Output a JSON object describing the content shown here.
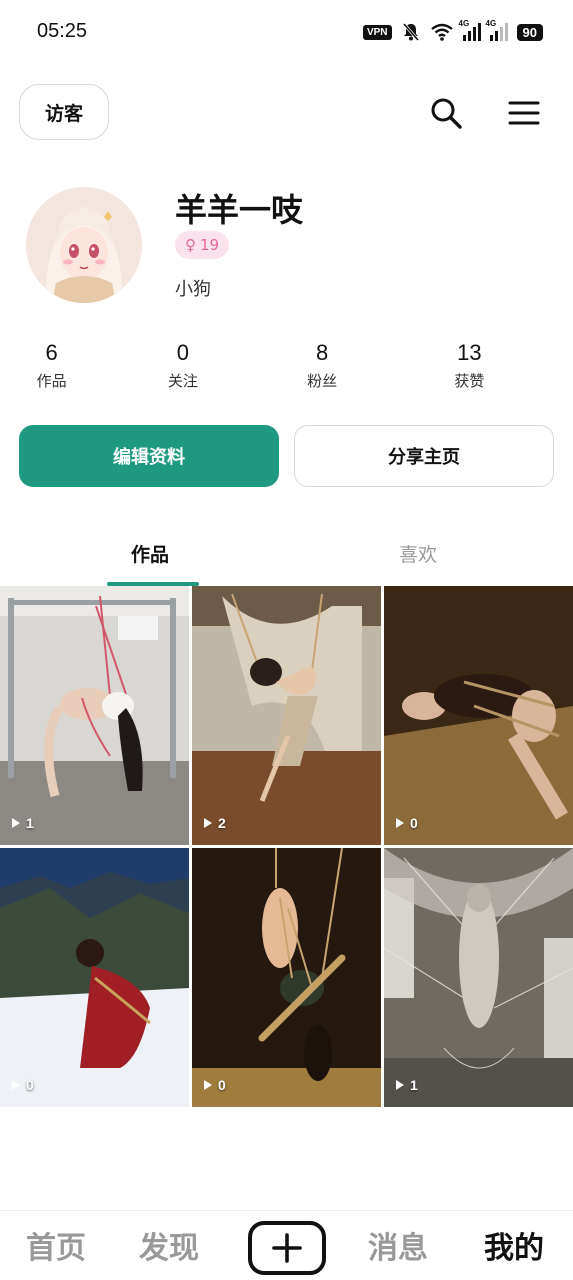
{
  "status_bar": {
    "time": "05:25",
    "vpn": "VPN",
    "net1": "4G",
    "net2": "4G",
    "battery": "90"
  },
  "header": {
    "visitor_label": "访客",
    "search_icon": "search-icon",
    "menu_icon": "menu-icon"
  },
  "profile": {
    "username": "羊羊一吱",
    "gender_symbol": "♀",
    "age": "19",
    "bio": "小狗"
  },
  "stats": [
    {
      "value": "6",
      "label": "作品"
    },
    {
      "value": "0",
      "label": "关注"
    },
    {
      "value": "8",
      "label": "粉丝"
    },
    {
      "value": "13",
      "label": "获赞"
    }
  ],
  "actions": {
    "edit_label": "编辑资料",
    "share_label": "分享主页"
  },
  "tabs": [
    {
      "label": "作品",
      "active": true
    },
    {
      "label": "喜欢",
      "active": false
    }
  ],
  "works": [
    {
      "count": "1"
    },
    {
      "count": "2"
    },
    {
      "count": "0"
    },
    {
      "count": "0"
    },
    {
      "count": "0"
    },
    {
      "count": "1"
    }
  ],
  "bottom_nav": {
    "home": "首页",
    "discover": "发现",
    "add_icon": "plus-icon",
    "messages": "消息",
    "me": "我的"
  },
  "colors": {
    "accent": "#1f9a80",
    "badge_bg": "#fbe3ee",
    "badge_fg": "#e4689b",
    "inactive": "#999999"
  }
}
